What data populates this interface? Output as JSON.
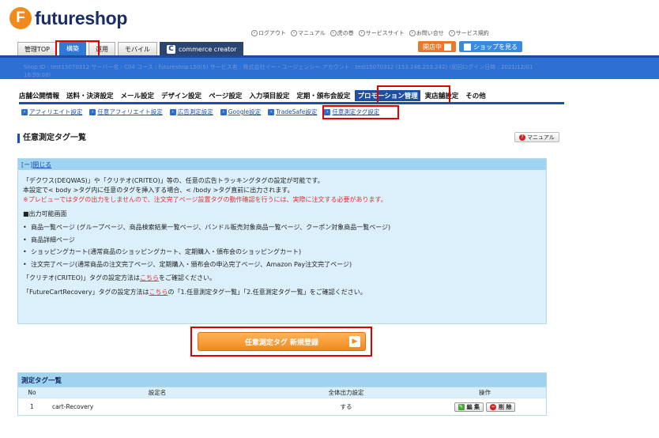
{
  "app": {
    "logo_mark": "F",
    "logo_text": "futureshop"
  },
  "toplinks": [
    "ログアウト",
    "マニュアル",
    "虎の巻",
    "サービスサイト",
    "お問い合せ",
    "サービス規約"
  ],
  "tabs": [
    {
      "label": "管理TOP"
    },
    {
      "label": "構築"
    },
    {
      "label": "運用"
    },
    {
      "label": "モバイル"
    },
    {
      "label": "commerce creator"
    }
  ],
  "shop": {
    "open_label": "開店中",
    "view_label": "ショップを見る"
  },
  "banner": {
    "line1": "Shop ID : test15070312 サーバー名 : C04 コース : futureshop L50(5) サービス名 : 株式会社イー・ユージェンシー アカウント : test15070312 (153.246.253.242) (前回ログイン日時 : 2021/12/01",
    "line2": "16:59:08)"
  },
  "mainnav": [
    "店舗公開情報",
    "送料・決済設定",
    "メール設定",
    "デザイン設定",
    "ページ設定",
    "入力項目設定",
    "定期・頒布会設定",
    "プロモーション管理",
    "実店舗設定",
    "その他"
  ],
  "subnav": [
    "アフィリエイト設定",
    "任意アフィリエイト設定",
    "広告測定設定",
    "Google設定",
    "TradeSafe設定",
    "任意測定タグ設定"
  ],
  "page": {
    "title": "任意測定タグ一覧",
    "manual_label": "マニュアル"
  },
  "info": {
    "toggle_label": "閉じる",
    "toggle_prefix": "[ー]",
    "line1": "「デクワス(DEQWAS)」や「クリテオ(CRITEO)」等の、任意の広告トラッキングタグの設定が可能です。",
    "line2": "本設定で< body >タグ内に任意のタグを挿入する場合、< /body >タグ直前に出力されます。",
    "line3": "※プレビューではタグの出力をしませんので、注文完了ページ設置タグの動作確認を行うには、実際に注文する必要があります。",
    "output_heading": "■出力可能画面",
    "output_items": [
      "商品一覧ページ (グループページ、商品検索結果一覧ページ、バンドル販売対象商品一覧ページ、クーポン対象商品一覧ページ)",
      "商品詳細ページ",
      "ショッピングカート(通常商品のショッピングカート、定期購入・頒布会のショッピングカート)",
      "注文完了ページ(通常商品の注文完了ページ、定期購入・頒布会の申込完了ページ、Amazon Pay注文完了ページ)"
    ],
    "criteo_pre": "「クリテオ(CRITEO)」タグの設定方法は",
    "criteo_link": "こちら",
    "criteo_post": "をご確認ください。",
    "fcr_pre": "「FutureCartRecovery」タグの設定方法は",
    "fcr_link": "こちら",
    "fcr_post": "の「1.任意測定タグ一覧」「2.任意測定タグ一覧」をご確認ください。"
  },
  "new_button": {
    "label": "任意測定タグ 新規登録"
  },
  "table": {
    "title": "測定タグ一覧",
    "columns": [
      "No",
      "設定名",
      "全体出力設定",
      "操作"
    ],
    "rows": [
      {
        "no": "1",
        "name": "cart-Recovery",
        "output": "する",
        "edit": "編 集",
        "delete": "削 除"
      }
    ]
  }
}
